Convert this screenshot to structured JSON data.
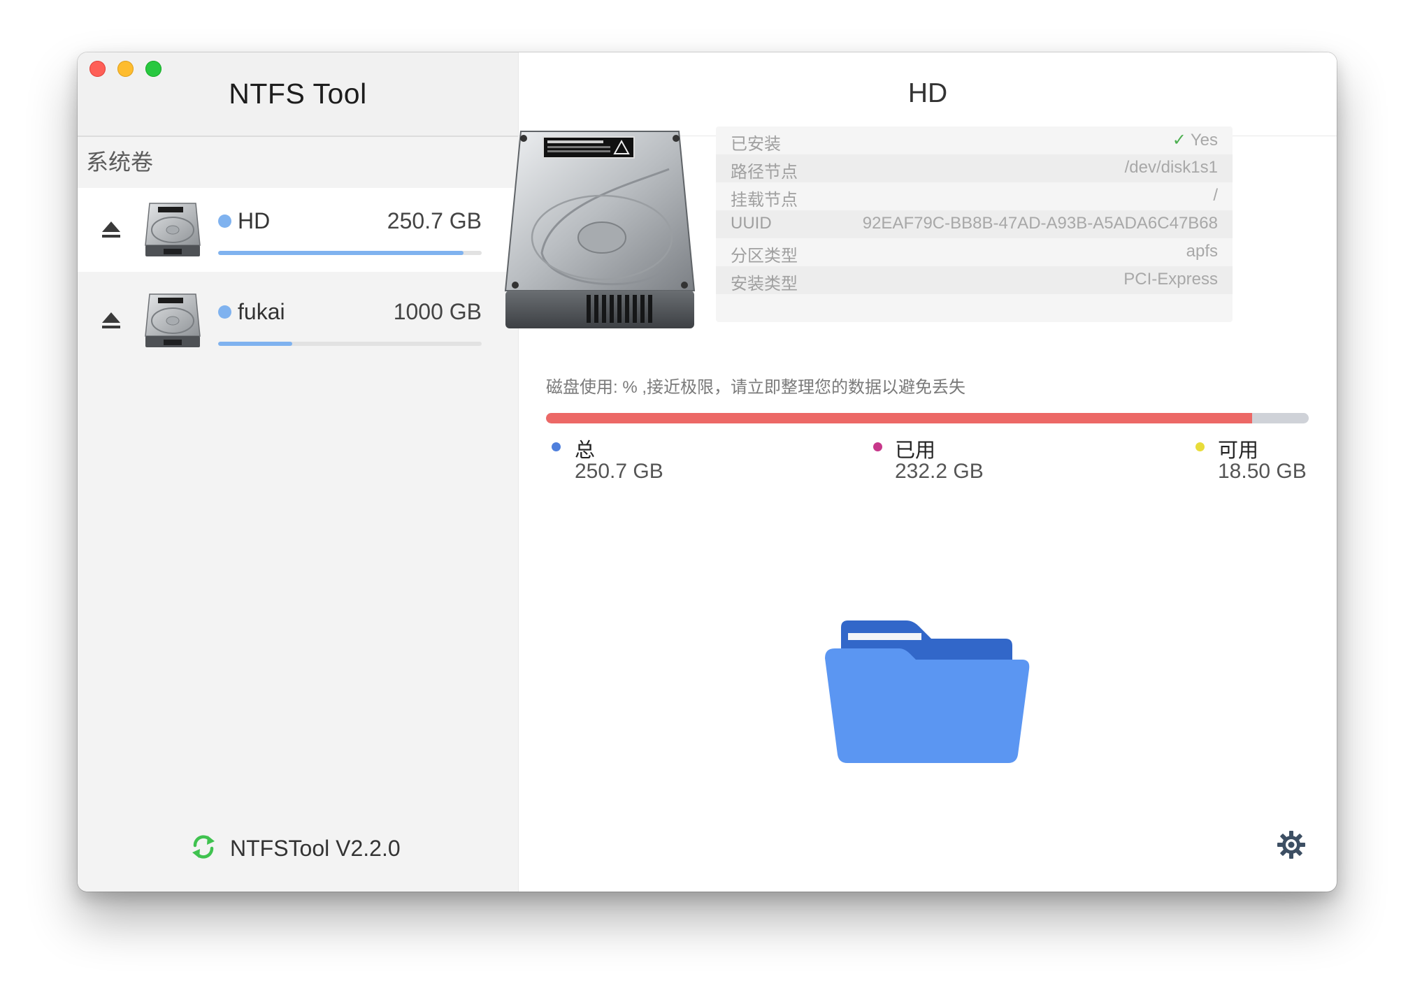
{
  "window": {
    "controls": [
      "close",
      "minimize",
      "zoom"
    ]
  },
  "sidebar": {
    "app_title": "NTFS Tool",
    "section_label": "系统卷",
    "volumes": [
      {
        "name": "HD",
        "size": "250.7 GB",
        "usage_fraction": 0.93,
        "selected": true,
        "icon": "hard-disk-icon"
      },
      {
        "name": "fukai",
        "size": "1000 GB",
        "usage_fraction": 0.28,
        "selected": false,
        "icon": "hard-disk-icon"
      }
    ],
    "footer": {
      "version": "NTFSTool V2.2.0",
      "icon": "refresh-icon"
    }
  },
  "main": {
    "title": "HD",
    "info": [
      {
        "key": "已安装",
        "value": "Yes",
        "check": true
      },
      {
        "key": "路径节点",
        "value": "/dev/disk1s1"
      },
      {
        "key": "挂载节点",
        "value": "/"
      },
      {
        "key": "UUID",
        "value": "92EAF79C-BB8B-47AD-A93B-A5ADA6C47B68"
      },
      {
        "key": "分区类型",
        "value": "apfs"
      },
      {
        "key": "安装类型",
        "value": "PCI-Express"
      }
    ],
    "usage_note": "磁盘使用: % ,接近极限，请立即整理您的数据以避免丢失",
    "usage_fraction": 0.926,
    "legend": [
      {
        "label": "总",
        "value": "250.7 GB",
        "color": "#4f7fdc"
      },
      {
        "label": "已用",
        "value": "232.2 GB",
        "color": "#c7378a"
      },
      {
        "label": "可用",
        "value": "18.50 GB",
        "color": "#e8dc3a"
      }
    ],
    "colors": {
      "usage_fill": "#ec6866",
      "usage_track": "#cfd2d8",
      "folder": "#5b96f2"
    }
  }
}
